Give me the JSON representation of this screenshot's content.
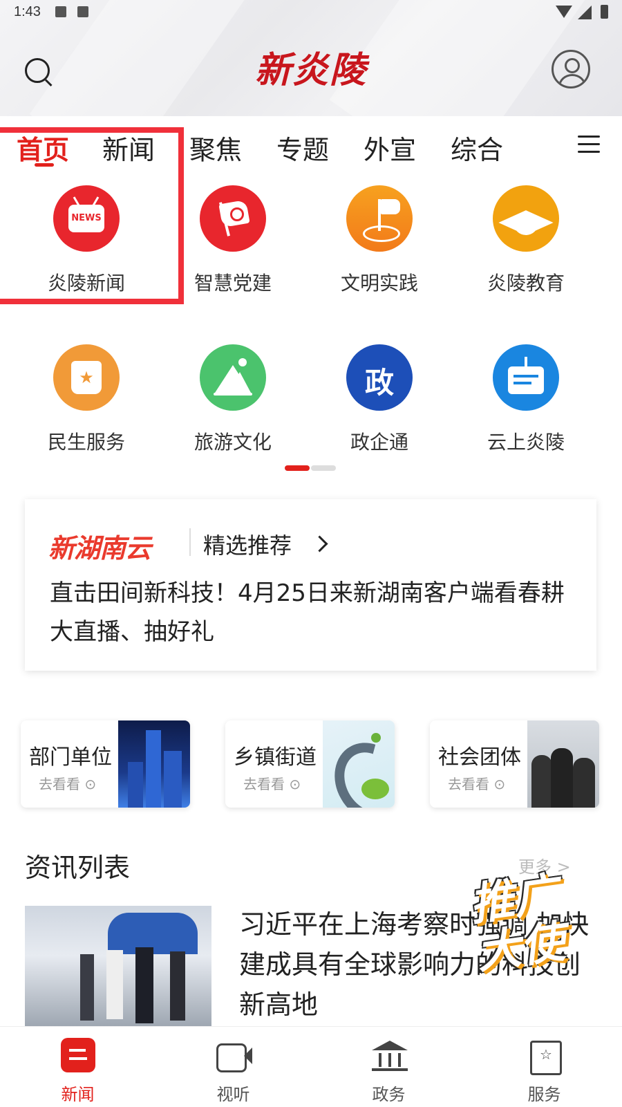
{
  "status_bar": {
    "time": "1:43"
  },
  "header": {
    "logo_text": "新炎陵"
  },
  "tabs": [
    {
      "label": "首页",
      "active": true
    },
    {
      "label": "新闻"
    },
    {
      "label": "聚焦"
    },
    {
      "label": "专题"
    },
    {
      "label": "外宣"
    },
    {
      "label": "综合"
    }
  ],
  "grid": [
    {
      "label": "炎陵新闻",
      "icon": "news-tv-icon",
      "color": "#e8262d",
      "badge_text": "NEWS"
    },
    {
      "label": "智慧党建",
      "icon": "party-flag-icon",
      "color": "#e8262d"
    },
    {
      "label": "文明实践",
      "icon": "flag-target-icon",
      "color": "#f6911e"
    },
    {
      "label": "炎陵教育",
      "icon": "graduation-cap-icon",
      "color": "#f2a20f"
    },
    {
      "label": "民生服务",
      "icon": "star-badge-icon",
      "color": "#f19a38"
    },
    {
      "label": "旅游文化",
      "icon": "mountain-icon",
      "color": "#4bc36d"
    },
    {
      "label": "政企通",
      "icon": "gov-icon",
      "color": "#1d4fb8",
      "badge_text": "政"
    },
    {
      "label": "云上炎陵",
      "icon": "board-sign-icon",
      "color": "#1a86e0"
    }
  ],
  "pager": {
    "page": 1,
    "total": 2
  },
  "recommend": {
    "brand": "新湖南云",
    "section": "精选推荐",
    "headline": "直击田间新科技！4月25日来新湖南客户端看春耕大直播、抽好礼"
  },
  "categories": [
    {
      "title": "部门单位",
      "sub": "去看看"
    },
    {
      "title": "乡镇街道",
      "sub": "去看看"
    },
    {
      "title": "社会团体",
      "sub": "去看看"
    }
  ],
  "news_list": {
    "title": "资讯列表",
    "more": "更多 >",
    "item": {
      "title": "习近平在上海考察时强调 加快建成具有全球影响力的科技创新高地"
    },
    "promo": "推广大使"
  },
  "bottom_nav": [
    {
      "label": "新闻",
      "icon": "news-icon",
      "active": true
    },
    {
      "label": "视听",
      "icon": "video-icon"
    },
    {
      "label": "政务",
      "icon": "government-icon"
    },
    {
      "label": "服务",
      "icon": "service-icon"
    }
  ],
  "colors": {
    "accent": "#e2211c"
  }
}
